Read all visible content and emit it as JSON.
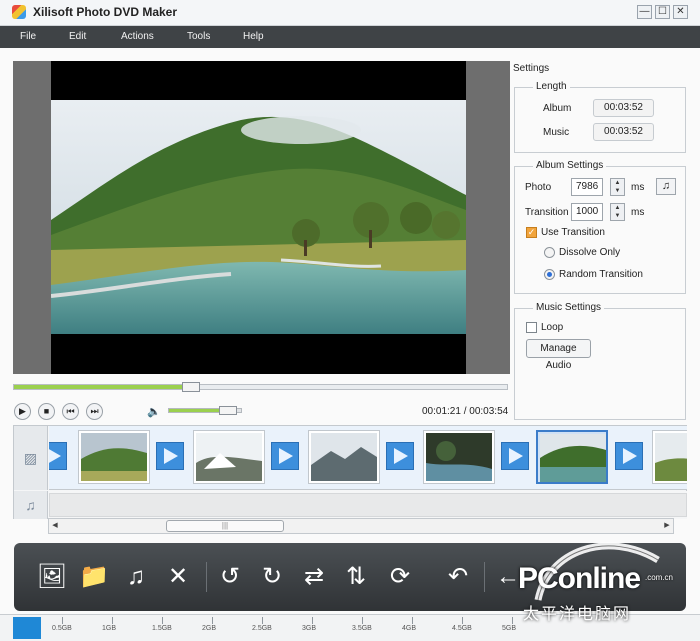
{
  "window": {
    "title": "Xilisoft Photo DVD Maker",
    "min_glyph": "—",
    "max_glyph": "☐",
    "close_glyph": "✕"
  },
  "menu": [
    "File",
    "Edit",
    "Actions",
    "Tools",
    "Help"
  ],
  "player": {
    "current_time": "00:01:21",
    "separator": " / ",
    "total_time": "00:03:54",
    "seek_fraction": 0.34,
    "volume_fraction": 0.82,
    "play_glyph": "▶",
    "stop_glyph": "■",
    "prev_glyph": "⏮",
    "next_glyph": "⏭",
    "volume_glyph": "🔈"
  },
  "settings": {
    "title": "Settings",
    "length": {
      "legend": "Length",
      "album_label": "Album",
      "album_value": "00:03:52",
      "music_label": "Music",
      "music_value": "00:03:52"
    },
    "album": {
      "legend": "Album Settings",
      "photo_label": "Photo",
      "photo_value": "7986",
      "photo_unit": "ms",
      "transition_label": "Transition",
      "transition_value": "1000",
      "transition_unit": "ms",
      "use_transition_label": "Use Transition",
      "use_transition_checked": true,
      "dissolve_label": "Dissolve Only",
      "random_label": "Random Transition",
      "selected_mode": "Random Transition",
      "music_note_glyph": "♫"
    },
    "music": {
      "legend": "Music Settings",
      "loop_label": "Loop",
      "loop_checked": false,
      "manage_audio_label": "Manage Audio"
    }
  },
  "timeline": {
    "photo_track_icon": "image-icon",
    "music_track_icon": "music-note-icon",
    "music_glyph": "♫",
    "selected_thumb_index": 4,
    "scroll_left_glyph": "◀",
    "scroll_right_glyph": "▶",
    "grip_glyph": "|||"
  },
  "toolbar": {
    "buttons": [
      {
        "icon": "add-photo-icon",
        "glyph": "🖼"
      },
      {
        "icon": "add-folder-icon",
        "glyph": "📁"
      },
      {
        "icon": "add-music-icon",
        "glyph": "♫"
      },
      {
        "icon": "delete-icon",
        "glyph": "✕"
      },
      {
        "icon": "rotate-left-icon",
        "glyph": "↺"
      },
      {
        "icon": "rotate-right-icon",
        "glyph": "↻"
      },
      {
        "icon": "swap-icon",
        "glyph": "⇄"
      },
      {
        "icon": "flip-icon",
        "glyph": "⇅"
      },
      {
        "icon": "transition-icon",
        "glyph": "⟳"
      },
      {
        "icon": "undo-icon",
        "glyph": "↶"
      },
      {
        "icon": "back-icon",
        "glyph": "←"
      }
    ]
  },
  "capacity": {
    "labels": [
      "0.5GB",
      "1GB",
      "1.5GB",
      "2GB",
      "2.5GB",
      "3GB",
      "3.5GB",
      "4GB",
      "4.5GB",
      "5GB"
    ],
    "used_fraction": 0.06
  },
  "watermark": {
    "brand": "PConline",
    "domain": ".com.cn",
    "chinese": "太平洋电脑网"
  },
  "colors": {
    "accent_green": "#9bd04e",
    "selection_blue": "#3b7cc9",
    "transition_blue": "#3d8fdc",
    "menubar": "#3f4346",
    "capacity_blue": "#1f88d6"
  }
}
